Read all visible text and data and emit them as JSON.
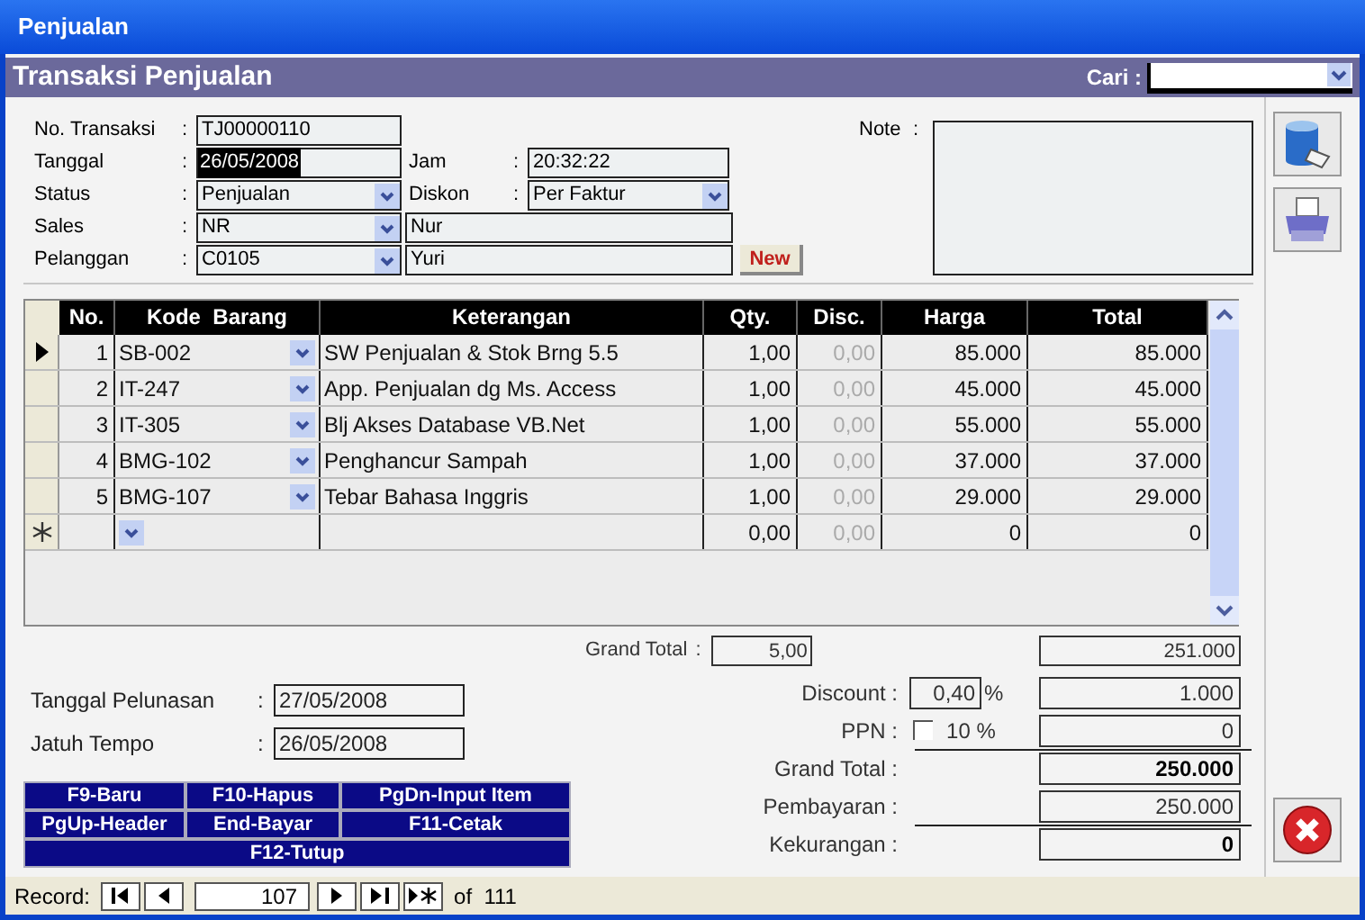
{
  "window": {
    "title": "Penjualan"
  },
  "header": {
    "title": "Transaksi Penjualan",
    "search_label": "Cari :"
  },
  "form": [
    {
      "label": "No. Transaksi",
      "sep": ":",
      "value": "TJ00000110",
      "kind": "text",
      "text_selected": false
    },
    {
      "label": "Tanggal",
      "sep": ":",
      "value": "26/05/2008",
      "kind": "text",
      "text_selected": true,
      "side": {
        "kind": "text_field",
        "label": "Jam",
        "sep": ":",
        "value": "20:32:22"
      }
    },
    {
      "label": "Status",
      "sep": ":",
      "value": "Penjualan",
      "kind": "combo",
      "text_selected": false,
      "side": {
        "kind": "combo_field",
        "label": "Diskon",
        "sep": ":",
        "value": "Per Faktur"
      }
    },
    {
      "label": "Sales",
      "sep": ":",
      "value": "NR",
      "kind": "combo",
      "text_selected": false,
      "side": {
        "kind": "name",
        "value": "Nur"
      }
    },
    {
      "label": "Pelanggan",
      "sep": ":",
      "value": "C0105",
      "kind": "combo",
      "text_selected": false,
      "side": {
        "kind": "name",
        "value": "Yuri"
      },
      "button": "New"
    }
  ],
  "note": {
    "label": "Note",
    "sep": ":"
  },
  "grid": {
    "columns": [
      "No.",
      "Kode  Barang",
      "Keterangan",
      "Qty.",
      "Disc.",
      "Harga",
      "Total"
    ],
    "rows": [
      {
        "kind": "current",
        "no": "1",
        "kode": "SB-002",
        "keterangan": "SW Penjualan & Stok Brng 5.5",
        "qty": "1,00",
        "disc": "0,00",
        "harga": "85.000",
        "total": "85.000"
      },
      {
        "kind": "plain",
        "no": "2",
        "kode": "IT-247",
        "keterangan": "App. Penjualan dg Ms. Access",
        "qty": "1,00",
        "disc": "0,00",
        "harga": "45.000",
        "total": "45.000"
      },
      {
        "kind": "plain",
        "no": "3",
        "kode": "IT-305",
        "keterangan": "Blj Akses Database VB.Net",
        "qty": "1,00",
        "disc": "0,00",
        "harga": "55.000",
        "total": "55.000"
      },
      {
        "kind": "plain",
        "no": "4",
        "kode": "BMG-102",
        "keterangan": "Penghancur Sampah",
        "qty": "1,00",
        "disc": "0,00",
        "harga": "37.000",
        "total": "37.000"
      },
      {
        "kind": "plain",
        "no": "5",
        "kode": "BMG-107",
        "keterangan": "Tebar Bahasa Inggris",
        "qty": "1,00",
        "disc": "0,00",
        "harga": "29.000",
        "total": "29.000"
      },
      {
        "kind": "new",
        "qty": "0,00",
        "disc": "0,00",
        "harga": "0",
        "total": "0"
      }
    ]
  },
  "totals": {
    "label": "Grand Total",
    "sep": ":",
    "qty": "5,00",
    "amount": "251.000"
  },
  "dates": [
    {
      "label": "Tanggal Pelunasan",
      "sep": ":",
      "value": "27/05/2008"
    },
    {
      "label": "Jatuh Tempo",
      "sep": ":",
      "value": "26/05/2008"
    }
  ],
  "shortcuts": [
    [
      "F9-Baru",
      "F10-Hapus",
      "PgDn-Input Item"
    ],
    [
      "PgUp-Header",
      "End-Bayar",
      "F11-Cetak"
    ],
    [
      "F12-Tutup"
    ]
  ],
  "summary": [
    {
      "kind": "percent",
      "label": "Discount :",
      "percent": "0,40",
      "unit": "%",
      "value": "1.000",
      "bold": false,
      "rule_above": false
    },
    {
      "kind": "check",
      "label": "PPN :",
      "checked": false,
      "rate": "10 %",
      "value": "0",
      "bold": false,
      "rule_above": false
    },
    {
      "kind": "plain",
      "label": "Grand Total :",
      "value": "250.000",
      "bold": true,
      "rule_above": true
    },
    {
      "kind": "plain",
      "label": "Pembayaran :",
      "value": "250.000",
      "bold": false,
      "rule_above": false
    },
    {
      "kind": "plain",
      "label": "Kekurangan :",
      "value": "0",
      "bold": true,
      "rule_above": true
    }
  ],
  "record_bar": {
    "label": "Record:",
    "current": "107",
    "total": "of  111"
  }
}
